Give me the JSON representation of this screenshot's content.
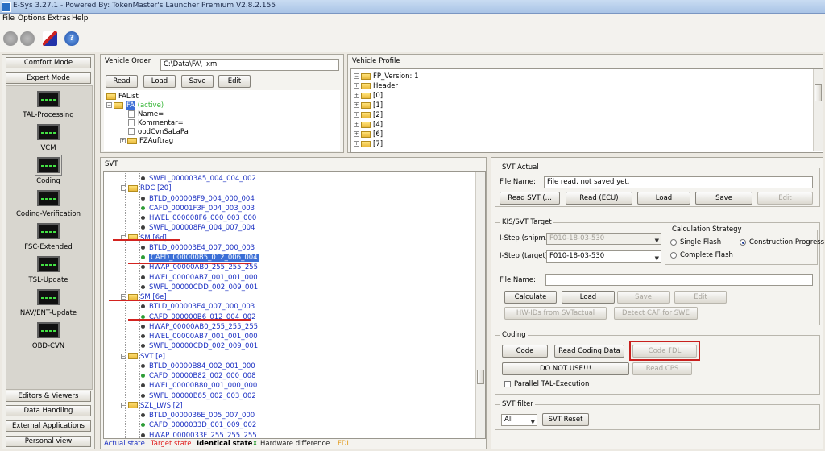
{
  "window": {
    "title": "E-Sys 3.27.1 - Powered By: TokenMaster's Launcher Premium V2.8.2.155"
  },
  "menu": [
    "File",
    "Options",
    "Extras",
    "Help"
  ],
  "left_panel": {
    "top_buttons": [
      "Comfort Mode",
      "Expert Mode"
    ],
    "tools": [
      "TAL-Processing",
      "VCM",
      "Coding",
      "Coding-Verification",
      "FSC-Extended",
      "TSL-Update",
      "NAV/ENT-Update",
      "OBD-CVN"
    ],
    "bottom_buttons": [
      "Editors & Viewers",
      "Data Handling",
      "External Applications",
      "Personal view"
    ]
  },
  "vehicle_order": {
    "title": "Vehicle Order",
    "path": "C:\\Data\\FA\\          .xml",
    "buttons": [
      "Read",
      "Load",
      "Save",
      "Edit"
    ],
    "tree": [
      "FAList",
      "FA",
      "(active)",
      "Name=",
      "Kommentar=",
      "obdCvnSaLaPa",
      "FZAuftrag"
    ]
  },
  "vehicle_profile": {
    "title": "Vehicle Profile",
    "tree": [
      "FP_Version: 1",
      "Header",
      "[0]",
      "[1]",
      "[2]",
      "[4]",
      "[6]",
      "[7]"
    ]
  },
  "svt": {
    "title": "SVT",
    "rows": [
      {
        "text": "SWFL_000003A5_004_004_002",
        "level": 2,
        "kind": "item",
        "dot": "dark"
      },
      {
        "text": "RDC [20]",
        "level": 1,
        "kind": "folder"
      },
      {
        "text": "BTLD_000008F9_004_000_004",
        "level": 2,
        "kind": "item",
        "dot": "dark"
      },
      {
        "text": "CAFD_00001F3F_004_003_003",
        "level": 2,
        "kind": "item",
        "dot": "green"
      },
      {
        "text": "HWEL_000008F6_000_003_000",
        "level": 2,
        "kind": "item",
        "dot": "dark"
      },
      {
        "text": "SWFL_000008FA_004_007_004",
        "level": 2,
        "kind": "item",
        "dot": "dark"
      },
      {
        "text": "SM [6d]",
        "level": 1,
        "kind": "folder"
      },
      {
        "text": "BTLD_000003E4_007_000_003",
        "level": 2,
        "kind": "item",
        "dot": "dark"
      },
      {
        "text": "CAFD_000000B5_012_006_004",
        "level": 2,
        "kind": "item",
        "dot": "green",
        "selected": true
      },
      {
        "text": "HWAP_00000AB0_255_255_255",
        "level": 2,
        "kind": "item",
        "dot": "dark"
      },
      {
        "text": "HWEL_00000AB7_001_001_000",
        "level": 2,
        "kind": "item",
        "dot": "dark"
      },
      {
        "text": "SWFL_00000CDD_002_009_001",
        "level": 2,
        "kind": "item",
        "dot": "dark"
      },
      {
        "text": "SM [6e]",
        "level": 1,
        "kind": "folder"
      },
      {
        "text": "BTLD_000003E4_007_000_003",
        "level": 2,
        "kind": "item",
        "dot": "dark"
      },
      {
        "text": "CAFD_000000B6_012_004_002",
        "level": 2,
        "kind": "item",
        "dot": "green"
      },
      {
        "text": "HWAP_00000AB0_255_255_255",
        "level": 2,
        "kind": "item",
        "dot": "dark"
      },
      {
        "text": "HWEL_00000AB7_001_001_000",
        "level": 2,
        "kind": "item",
        "dot": "dark"
      },
      {
        "text": "SWFL_00000CDD_002_009_001",
        "level": 2,
        "kind": "item",
        "dot": "dark"
      },
      {
        "text": "SVT [e]",
        "level": 1,
        "kind": "folder"
      },
      {
        "text": "BTLD_00000B84_002_001_000",
        "level": 2,
        "kind": "item",
        "dot": "dark"
      },
      {
        "text": "CAFD_00000B82_002_000_008",
        "level": 2,
        "kind": "item",
        "dot": "green"
      },
      {
        "text": "HWEL_00000B80_001_000_000",
        "level": 2,
        "kind": "item",
        "dot": "dark"
      },
      {
        "text": "SWFL_00000B85_002_003_002",
        "level": 2,
        "kind": "item",
        "dot": "dark"
      },
      {
        "text": "SZL_LWS [2]",
        "level": 1,
        "kind": "folder"
      },
      {
        "text": "BTLD_0000036E_005_007_000",
        "level": 2,
        "kind": "item",
        "dot": "dark"
      },
      {
        "text": "CAFD_0000033D_001_009_002",
        "level": 2,
        "kind": "item",
        "dot": "green"
      },
      {
        "text": "HWAP_0000033F_255_255_255",
        "level": 2,
        "kind": "item",
        "dot": "dark"
      }
    ],
    "legend": {
      "actual": "Actual state",
      "target": "Target state",
      "identical": "Identical state",
      "diff": "Hardware difference",
      "fdl": "FDL"
    }
  },
  "svt_actual": {
    "title": "SVT Actual",
    "file_label": "File Name:",
    "file_value": "File read, not saved yet.",
    "buttons": [
      "Read SVT (...",
      "Read (ECU)",
      "Load",
      "Save",
      "Edit"
    ]
  },
  "kis_target": {
    "title": "KIS/SVT Target",
    "istep_shipm_label": "I-Step (shipm.):",
    "istep_shipm_value": "F010-18-03-530",
    "istep_target_label": "I-Step (target):",
    "istep_target_value": "F010-18-03-530",
    "calc_title": "Calculation Strategy",
    "calc_options": [
      "Single Flash",
      "Construction Progress",
      "Complete Flash"
    ],
    "calc_selected": "Construction Progress",
    "file_label": "File Name:",
    "buttons": [
      "Calculate",
      "Load",
      "Save",
      "Edit"
    ],
    "buttons2": [
      "HW-IDs from SVTactual",
      "Detect CAF for SWE"
    ]
  },
  "coding": {
    "title": "Coding",
    "buttons": [
      "Code",
      "Read Coding Data",
      "Code FDL"
    ],
    "buttons2": [
      "DO NOT USE!!!",
      "Read CPS"
    ],
    "parallel_label": "Parallel TAL-Execution"
  },
  "svt_filter": {
    "title": "SVT filter",
    "value": "All",
    "reset": "SVT Reset"
  },
  "colors": {
    "highlight": "#3c6fd6",
    "annotation_red": "#d3231f",
    "code_fdl_box": "#c8201e",
    "blue_text": "#1a2fc2",
    "target_red": "#e01c1c",
    "fdl_orange": "#e29a1a"
  }
}
